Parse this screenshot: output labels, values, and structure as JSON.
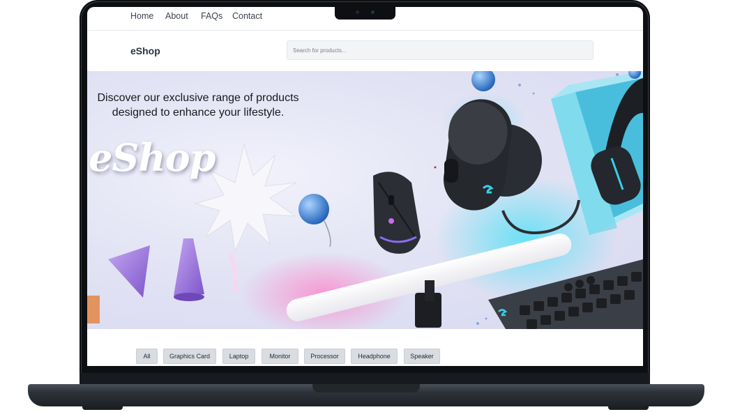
{
  "nav": {
    "links": [
      "Home",
      "About",
      "FAQs",
      "Contact"
    ]
  },
  "header": {
    "brand": "eShop",
    "search_placeholder": "Search for products..."
  },
  "hero": {
    "headline_line1": "Discover our exclusive range of products",
    "headline_line2": "designed to enhance your lifestyle.",
    "script_logo": "eShop"
  },
  "categories": [
    "All",
    "Graphics Card",
    "Laptop",
    "Monitor",
    "Processor",
    "Headphone",
    "Speaker"
  ],
  "colors": {
    "accent_cyan": "#35d0ea",
    "text_dark": "#2b3342",
    "chip_bg": "#d9dde2"
  }
}
